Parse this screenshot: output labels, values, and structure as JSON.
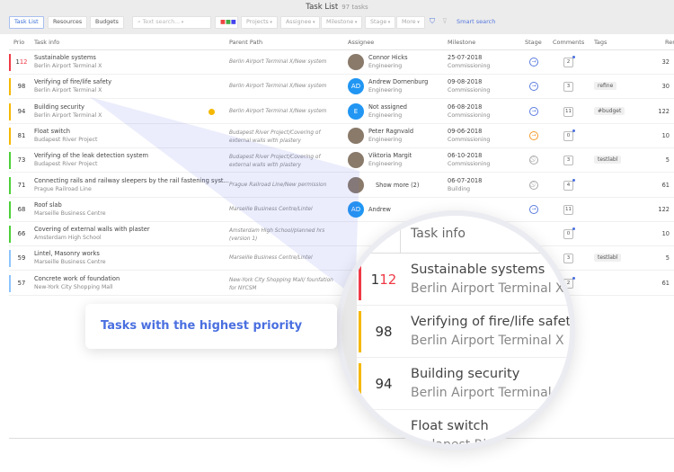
{
  "header": {
    "title": "Task List",
    "count": "97 tasks"
  },
  "toolbar": {
    "tabs": [
      "Task List",
      "Resources",
      "Budgets"
    ],
    "search_placeholder": "Text search...",
    "filters": [
      "Projects",
      "Assignee",
      "Milestone",
      "Stage",
      "More"
    ],
    "smart_search": "Smart search"
  },
  "columns": [
    "Prio",
    "Task info",
    "Parent Path",
    "Assignee",
    "Milestone",
    "Stage",
    "Comments",
    "Tags",
    "Rem"
  ],
  "colors": {
    "red": "#f03a47",
    "orange": "#f5b800",
    "green": "#4cd137",
    "blue": "#8ec5ff",
    "accent": "#4a6fe0"
  },
  "rows": [
    {
      "prio": "112",
      "color": "red",
      "name": "Sustainable systems",
      "sub": "Berlin Airport Terminal X",
      "path": "Berlin Airport Terminal X/New system",
      "assignee": "Connor Hicks",
      "dept": "Engineering",
      "avatar": "",
      "date": "25-07-2018",
      "phase": "Commissioning",
      "stage": "blue",
      "comments": "2",
      "new": true,
      "tag": "",
      "rem": "32"
    },
    {
      "prio": "98",
      "color": "orange",
      "name": "Verifying of fire/life safety",
      "sub": "Berlin Airport Terminal X",
      "path": "Berlin Airport Terminal X/New system",
      "assignee": "Andrew Dornenburg",
      "dept": "Engineering",
      "avatar": "AD",
      "date": "09-08-2018",
      "phase": "Commissioning",
      "stage": "blue",
      "comments": "3",
      "new": false,
      "tag": "refine",
      "rem": "30"
    },
    {
      "prio": "94",
      "color": "orange",
      "name": "Building security",
      "sub": "Berlin Airport Terminal X",
      "path": "Berlin Airport Terminal X/New system",
      "assignee": "Not assigned",
      "dept": "Engineering",
      "avatar": "E",
      "date": "06-08-2018",
      "phase": "Commissioning",
      "stage": "blue",
      "comments": "11",
      "new": false,
      "tag": "#budget",
      "rem": "122"
    },
    {
      "prio": "81",
      "color": "orange",
      "name": "Float switch",
      "sub": "Budapest River Project",
      "path": "Budapest River Project/Covering of external walls with plastery",
      "assignee": "Peter Ragnvald",
      "dept": "Engineering",
      "avatar": "",
      "date": "09-06-2018",
      "phase": "Commissioning",
      "stage": "orange",
      "comments": "0",
      "new": true,
      "tag": "",
      "rem": "10"
    },
    {
      "prio": "73",
      "color": "green",
      "name": "Verifying of the leak detection system",
      "sub": "Budapest River Project",
      "path": "Budapest River Project/Covering of external walls with plastery",
      "assignee": "Viktoria Margit",
      "dept": "Engineering",
      "avatar": "",
      "date": "06-10-2018",
      "phase": "Commissioning",
      "stage": "none",
      "comments": "3",
      "new": false,
      "tag": "testlabl",
      "rem": "5"
    },
    {
      "prio": "71",
      "color": "green",
      "name": "Connecting rails and railway sleepers by the rail fastening syst...",
      "sub": "Prague Railroad Line",
      "path": "Prague Railroad Line/New permission",
      "assignee": "Show more (2)",
      "dept": "",
      "avatar": "",
      "date": "06-07-2018",
      "phase": "Building",
      "stage": "none",
      "comments": "4",
      "new": true,
      "tag": "",
      "rem": "61"
    },
    {
      "prio": "68",
      "color": "green",
      "name": "Roof slab",
      "sub": "Marseille Business Centre",
      "path": "Marseille Business Centre/Lintel",
      "assignee": "Andrew",
      "dept": "",
      "avatar": "AD",
      "date": "",
      "phase": "",
      "stage": "blue",
      "comments": "11",
      "new": false,
      "tag": "",
      "rem": "122"
    },
    {
      "prio": "66",
      "color": "green",
      "name": "Covering of external walls with plaster",
      "sub": "Amsterdam High School",
      "path": "Amsterdam High School/planned hrs (version 1)",
      "assignee": "",
      "dept": "",
      "avatar": "",
      "date": "",
      "phase": "",
      "stage": "",
      "comments": "0",
      "new": true,
      "tag": "",
      "rem": "10"
    },
    {
      "prio": "59",
      "color": "blue",
      "name": "Lintel, Masonry works",
      "sub": "Marseille Business Centre",
      "path": "Marseille Business Centre/Lintel",
      "assignee": "",
      "dept": "",
      "avatar": "",
      "date": "",
      "phase": "",
      "stage": "",
      "comments": "3",
      "new": false,
      "tag": "testlabl",
      "rem": "5"
    },
    {
      "prio": "57",
      "color": "blue",
      "name": "Concrete work of foundation",
      "sub": "New-York City Shopping Mall",
      "path": "New-York City Shopping Mall/ founfation for NYCSM",
      "assignee": "",
      "dept": "",
      "avatar": "",
      "date": "",
      "phase": "",
      "stage": "",
      "comments": "2",
      "new": true,
      "tag": "",
      "rem": "61"
    }
  ],
  "callout": "Tasks with the highest priority"
}
